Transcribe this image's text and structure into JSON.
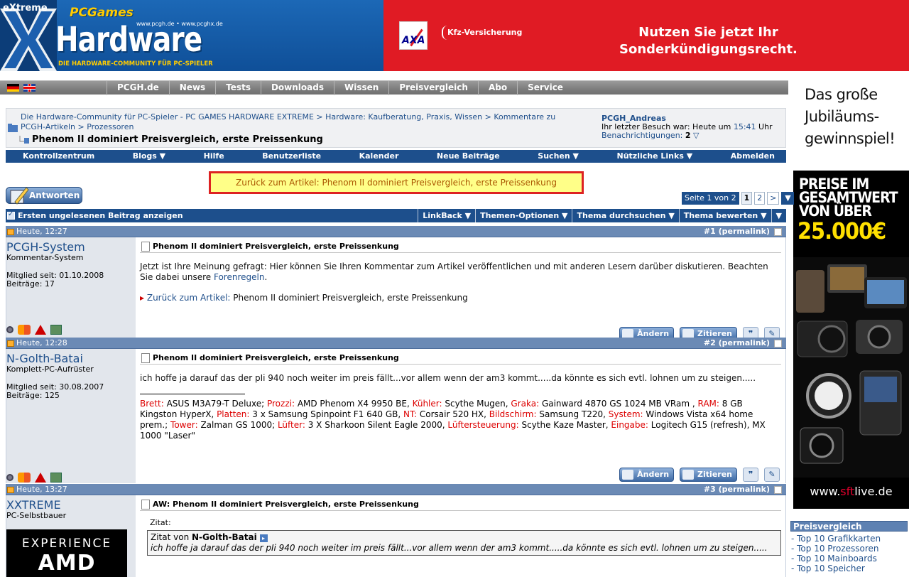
{
  "banner": {
    "extreme": "eXtreme",
    "pcgames": "PCGames",
    "hardware": "Hardware",
    "urls": "www.pcgh.de • www.pcghx.de",
    "tagline": "DIE HARDWARE-COMMUNITY FÜR PC-SPIELER",
    "ad_brand": "AXA",
    "ad_product": "Kfz-Versicherung",
    "ad_headline_1": "Nutzen Sie jetzt Ihr",
    "ad_headline_2": "Sonderkündigungsrecht."
  },
  "skyscraper": {
    "line1": "Das große",
    "line2": "Jubiläums-",
    "line3": "gewinnspiel!",
    "preise1": "PREISE IM",
    "preise2": "GESAMTWERT",
    "preise3": "VON ÜBER",
    "amount": "25.000€",
    "url_prefix": "www.",
    "url_brand": "sft",
    "url_suffix": "live.de"
  },
  "topnav": {
    "items": [
      "PCGH.de",
      "News",
      "Tests",
      "Downloads",
      "Wissen",
      "Preisvergleich",
      "Abo",
      "Service"
    ]
  },
  "breadcrumb": {
    "line1": "Die Hardware-Community für PC-Spieler - PC GAMES HARDWARE EXTREME > Hardware: Kaufberatung, Praxis, Wissen > Kommentare zu",
    "line2": "PCGH-Artikeln > Prozessoren",
    "title": "Phenom II dominiert Preisvergleich, erste Preissenkung",
    "user": "PCGH_Andreas",
    "last_visit_prefix": "Ihr letzter Besuch war: Heute um ",
    "last_visit_time": "15:41",
    "last_visit_suffix": " Uhr",
    "notifications_label": "Benachrichtigungen: ",
    "notifications_count": "2"
  },
  "navbar": {
    "items": [
      "Kontrollzentrum",
      "Blogs ▼",
      "Hilfe",
      "Benutzerliste",
      "Kalender",
      "Neue Beiträge",
      "Suchen ▼",
      "Nützliche Links ▼",
      "Abmelden"
    ]
  },
  "back_box": "Zurück zum Artikel: Phenom II dominiert Preisvergleich, erste Preissenkung",
  "reply_label": "Antworten",
  "pager": {
    "label": "Seite 1 von 2",
    "current": "1",
    "next_page": "2",
    "next": ">",
    "dropdown": "▼"
  },
  "thread_bar": {
    "first_unread": "Ersten ungelesenen Beitrag anzeigen",
    "items": [
      "LinkBack ▼",
      "Themen-Optionen ▼",
      "Thema durchsuchen ▼",
      "Thema bewerten ▼",
      "▼"
    ]
  },
  "posts": [
    {
      "date": "Heute, 12:27",
      "num": "#1 (permalink)",
      "user": "PCGH-System",
      "user_title": "Kommentar-System",
      "join": "Mitglied seit: 01.10.2008",
      "count": "Beiträge: 17",
      "title": "Phenom II dominiert Preisvergleich, erste Preissenkung",
      "text": "Jetzt ist Ihre Meinung gefragt: Hier können Sie Ihren Kommentar zum Artikel veröffentlichen und mit anderen Lesern darüber diskutieren. Beachten Sie dabei unsere ",
      "rules_link": "Forenregeln",
      "text_end": ".",
      "back_label": "Zurück zum Artikel:",
      "back_title": " Phenom II dominiert Preisvergleich, erste Preissenkung"
    },
    {
      "date": "Heute, 12:28",
      "num": "#2 (permalink)",
      "user": "N-Golth-Batai",
      "user_title": "Komplett-PC-Aufrüster",
      "join": "Mitglied seit: 30.08.2007",
      "count": "Beiträge: 125",
      "title": "Phenom II dominiert Preisvergleich, erste Preissenkung",
      "text": "ich hoffe ja darauf das der pIi 940 noch weiter im preis fällt...vor allem wenn der am3 kommt.....da könnte es sich evtl. lohnen um zu steigen.....",
      "sig": [
        {
          "k": "Brett:",
          "v": " ASUS M3A79-T Deluxe; "
        },
        {
          "k": "Prozzi:",
          "v": " AMD Phenom X4 9950 BE, "
        },
        {
          "k": "Kühler:",
          "v": " Scythe Mugen, "
        },
        {
          "k": "Graka:",
          "v": " Gainward 4870 GS 1024 MB VRam , "
        },
        {
          "k": "RAM:",
          "v": " 8 GB Kingston HyperX, "
        },
        {
          "k": "Platten:",
          "v": " 3 x Samsung Spinpoint F1 640 GB, "
        },
        {
          "k": "NT:",
          "v": " Corsair 520 HX, "
        },
        {
          "k": "Bildschirm:",
          "v": " Samsung T220, "
        },
        {
          "k": "System:",
          "v": " Windows Vista x64 home prem.; "
        },
        {
          "k": "Tower:",
          "v": " Zalman GS 1000; "
        },
        {
          "k": "Lüfter:",
          "v": " 3 X Sharkoon Silent Eagle 2000, "
        },
        {
          "k": "Lüftersteuerung:",
          "v": " Scythe Kaze Master, "
        },
        {
          "k": "Eingabe:",
          "v": " Logitech G15 (refresh), MX 1000 \"Laser\""
        }
      ]
    },
    {
      "date": "Heute, 13:27",
      "num": "#3 (permalink)",
      "user": "XXTREME",
      "user_title": "PC-Selbstbauer",
      "title": "AW: Phenom II dominiert Preisvergleich, erste Preissenkung",
      "quote_label": "Zitat:",
      "quote_from": "Zitat von ",
      "quote_user": "N-Golth-Batai",
      "quote_text": "ich hoffe ja darauf das der pIi 940 noch weiter im preis fällt...vor allem wenn der am3 kommt.....da könnte es sich evtl. lohnen um zu steigen.....",
      "avatar_line1": "EXPERIENCE",
      "avatar_line2": "AMD"
    }
  ],
  "actions": {
    "edit": "Ändern",
    "quote": "Zitieren"
  },
  "preisvergleich": {
    "title": "Preisvergleich",
    "items": [
      "- Top 10 Grafikkarten",
      "- Top 10 Prozessoren",
      "- Top 10 Mainboards",
      "- Top 10 Speicher"
    ]
  }
}
